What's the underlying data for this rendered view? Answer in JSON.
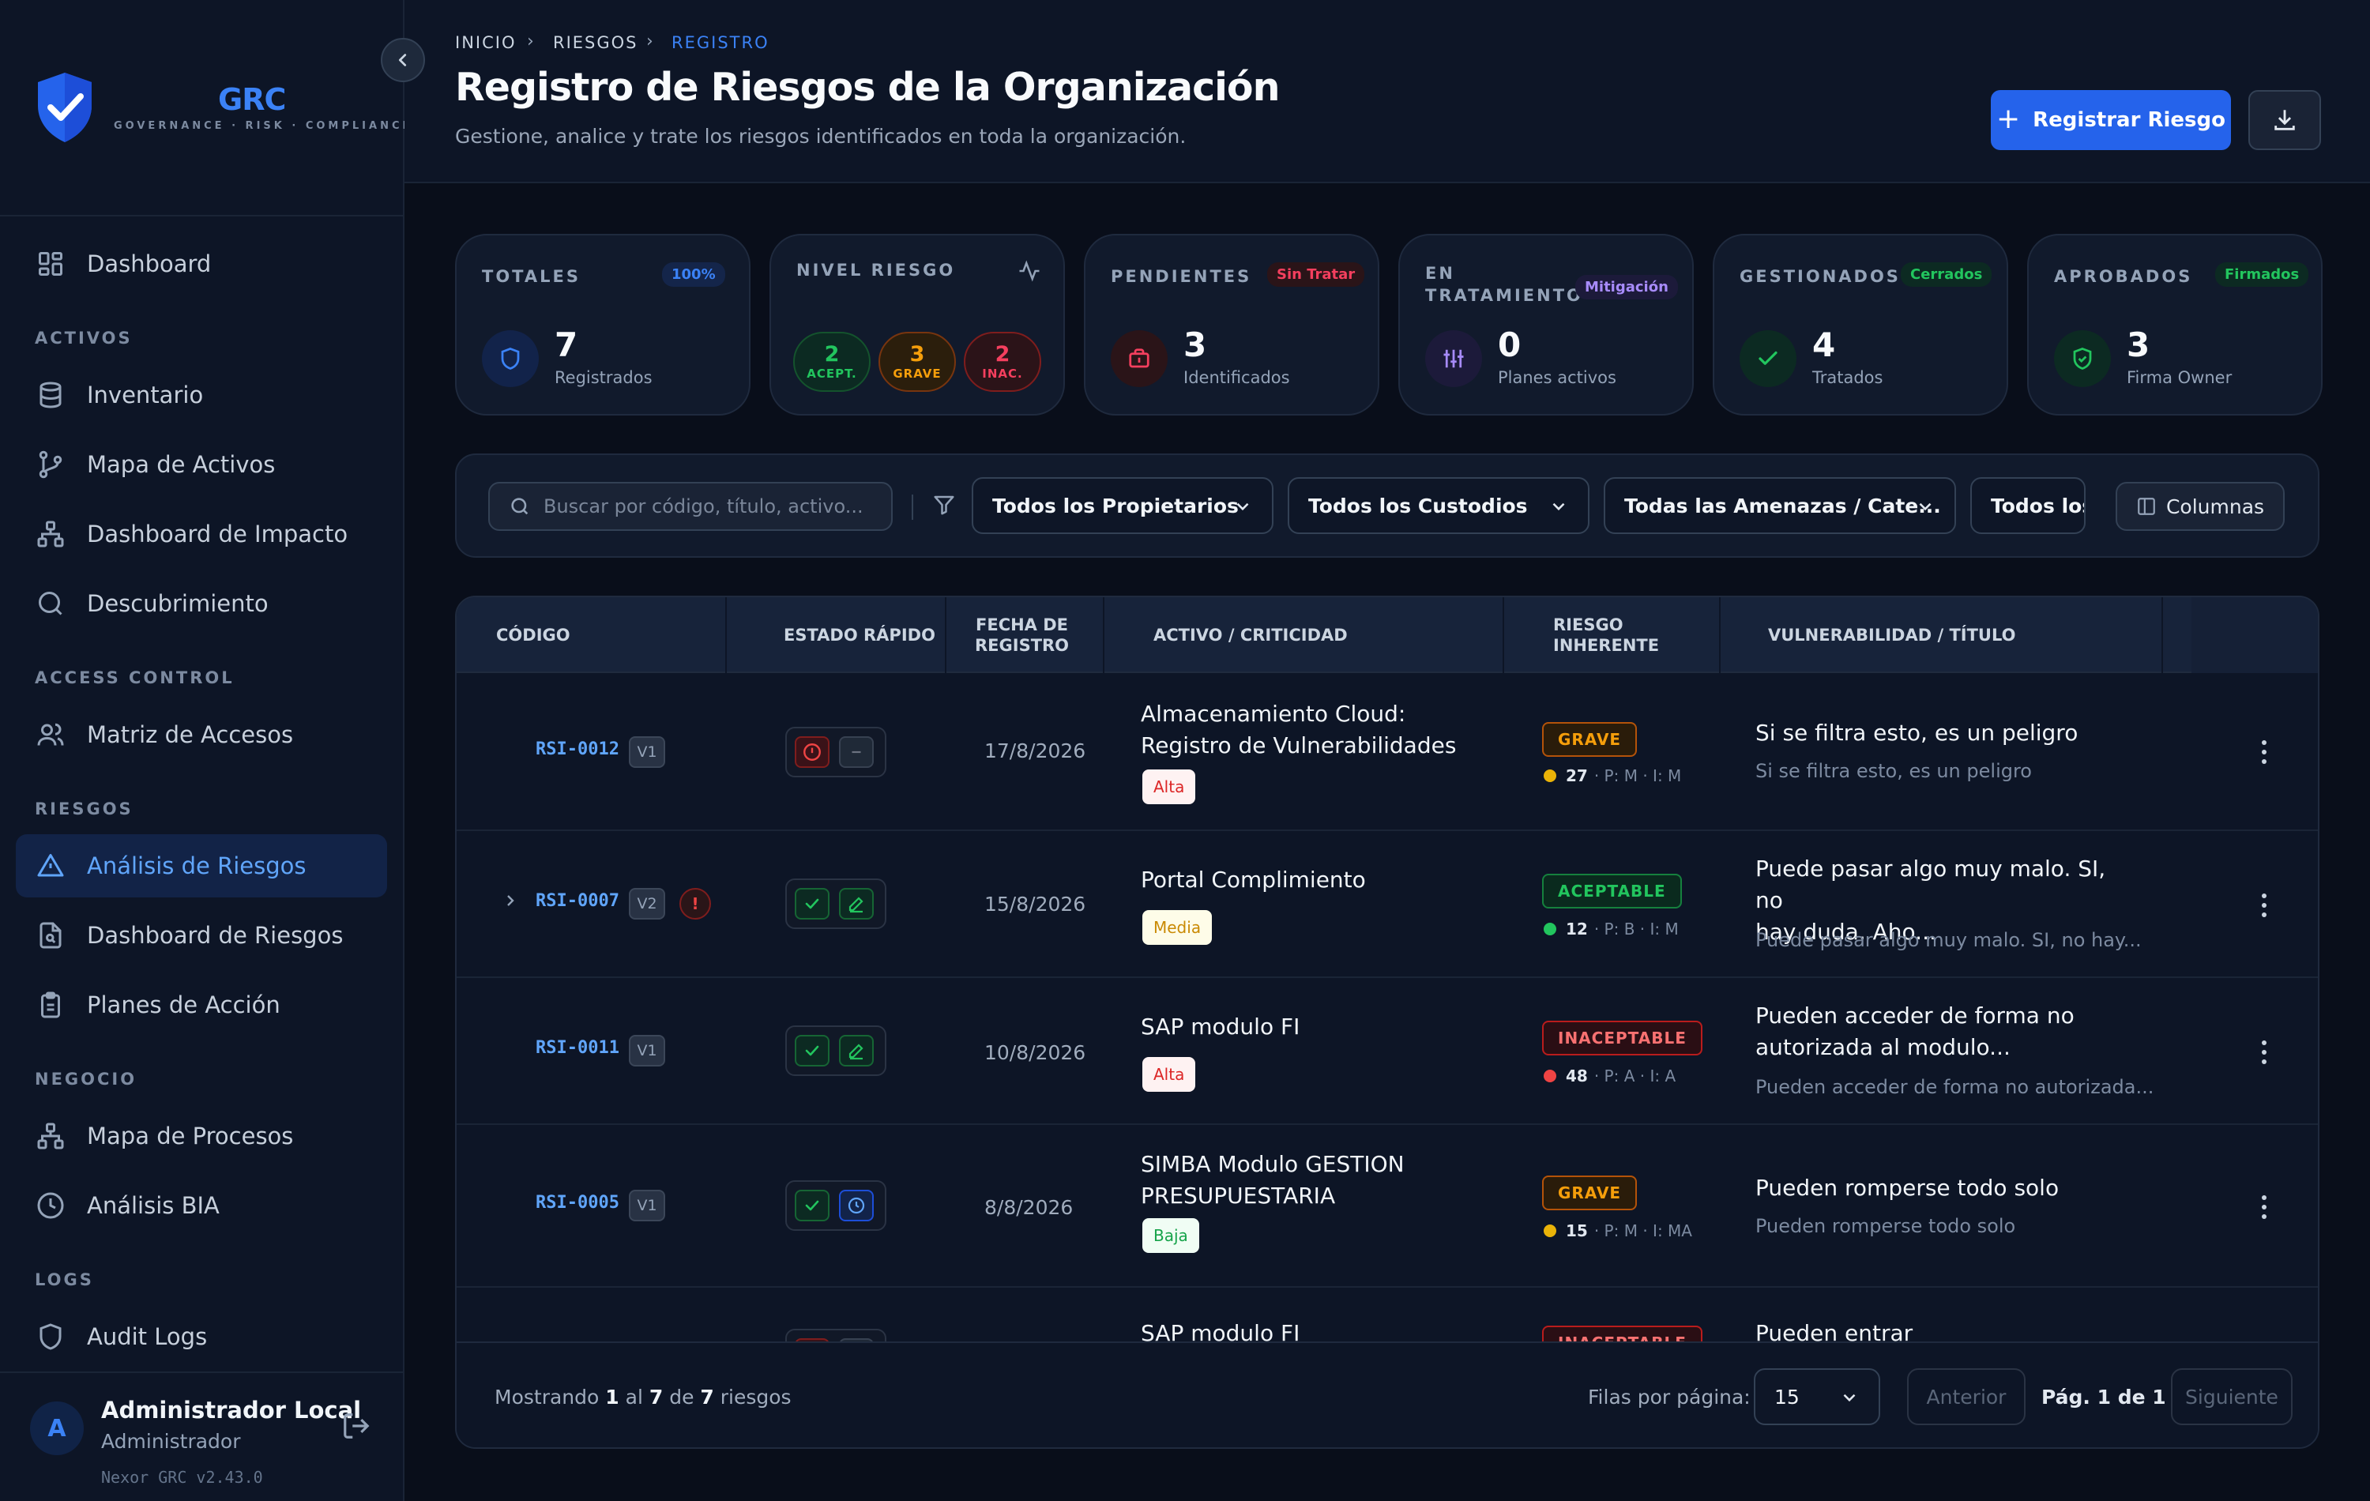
{
  "brand": {
    "name": "GRC",
    "tagline": "GOVERNANCE · RISK · COMPLIANCE",
    "accent": "#3b82f6"
  },
  "sidebar": {
    "dashboard": "Dashboard",
    "sections": [
      "ACTIVOS",
      "ACCESS CONTROL",
      "RIESGOS",
      "NEGOCIO",
      "LOGS"
    ],
    "items": [
      {
        "label": "Inventario",
        "icon": "database-icon"
      },
      {
        "label": "Mapa de Activos",
        "icon": "git-branch-icon"
      },
      {
        "label": "Dashboard de Impacto",
        "icon": "hierarchy-icon"
      },
      {
        "label": "Descubrimiento",
        "icon": "search-icon"
      },
      {
        "label": "Matriz de Accesos",
        "icon": "users-icon"
      },
      {
        "label": "Análisis de Riesgos",
        "icon": "warning-icon",
        "active": true
      },
      {
        "label": "Dashboard de Riesgos",
        "icon": "file-search-icon"
      },
      {
        "label": "Planes de Acción",
        "icon": "clipboard-icon"
      },
      {
        "label": "Mapa de Procesos",
        "icon": "hierarchy-icon"
      },
      {
        "label": "Análisis BIA",
        "icon": "clock-icon"
      },
      {
        "label": "Audit Logs",
        "icon": "shield-icon"
      }
    ],
    "user": {
      "initial": "A",
      "name": "Administrador Local",
      "role": "Administrador"
    },
    "version": "Nexor GRC v2.43.0"
  },
  "breadcrumb": [
    "INICIO",
    "RIESGOS",
    "REGISTRO"
  ],
  "page": {
    "title": "Registro de Riesgos de la Organización",
    "subtitle": "Gestione, analice y trate los riesgos identificados en toda la organización.",
    "primary_button": "Registrar Riesgo"
  },
  "stats": {
    "totales": {
      "title": "TOTALES",
      "badge": "100%",
      "value": "7",
      "label": "Registrados"
    },
    "nivel": {
      "title": "NIVEL RIESGO",
      "pills": [
        {
          "value": "2",
          "label": "ACEPT."
        },
        {
          "value": "3",
          "label": "GRAVE"
        },
        {
          "value": "2",
          "label": "INAC."
        }
      ]
    },
    "pendientes": {
      "title": "PENDIENTES",
      "badge": "Sin Tratar",
      "value": "3",
      "label": "Identificados"
    },
    "tratamiento": {
      "title_1": "EN",
      "title_2": "TRATAMIENTO",
      "badge": "Mitigación",
      "value": "0",
      "label": "Planes activos"
    },
    "gestionados": {
      "title": "GESTIONADOS",
      "badge": "Cerrados",
      "value": "4",
      "label": "Tratados"
    },
    "aprobados": {
      "title": "APROBADOS",
      "badge": "Firmados",
      "value": "3",
      "label": "Firma Owner"
    }
  },
  "filters": {
    "search_placeholder": "Buscar por código, título, activo...",
    "owners": "Todos los Propietarios",
    "custodians": "Todos los Custodios",
    "threats": "Todas las Amenazas / Cate...",
    "more": "Todos los",
    "columns": "Columnas"
  },
  "table": {
    "headers": {
      "code": "CÓDIGO",
      "quick": "ESTADO RÁPIDO",
      "date_1": "FECHA DE",
      "date_2": "REGISTRO",
      "asset": "ACTIVO / CRITICIDAD",
      "risk_1": "RIESGO",
      "risk_2": "INHERENTE",
      "vuln": "VULNERABILIDAD / TÍTULO"
    },
    "rows": [
      {
        "code": "RSI-0012",
        "version": "V1",
        "date": "17/8/2026",
        "asset_1": "Almacenamiento Cloud:",
        "asset_2": "Registro de Vulnerabilidades",
        "criticality": "Alta",
        "risk": "GRAVE",
        "score": "27",
        "score_detail": "· P: M · I: M",
        "title_1": "Si se filtra esto, es un peligro",
        "title_2": "",
        "subtitle": "Si se filtra esto, es un peligro"
      },
      {
        "code": "RSI-0007",
        "version": "V2",
        "alert": "!",
        "date": "15/8/2026",
        "asset_1": "Portal Complimiento",
        "asset_2": "",
        "criticality": "Media",
        "risk": "ACEPTABLE",
        "score": "12",
        "score_detail": "· P: B · I: M",
        "title_1": "Puede pasar algo muy malo. SI, no",
        "title_2": "hay duda. Aho...",
        "subtitle": "Puede pasar algo muy malo. SI, no hay..."
      },
      {
        "code": "RSI-0011",
        "version": "V1",
        "date": "10/8/2026",
        "asset_1": "SAP modulo FI",
        "asset_2": "",
        "criticality": "Alta",
        "risk": "INACEPTABLE",
        "score": "48",
        "score_detail": "· P: A · I: A",
        "title_1": "Pueden acceder de forma no",
        "title_2": "autorizada al modulo...",
        "subtitle": "Pueden acceder de forma no autorizada..."
      },
      {
        "code": "RSI-0005",
        "version": "V1",
        "date": "8/8/2026",
        "asset_1": "SIMBA Modulo GESTION",
        "asset_2": "PRESUPUESTARIA",
        "criticality": "Baja",
        "risk": "GRAVE",
        "score": "15",
        "score_detail": "· P: M · I: MA",
        "title_1": "Pueden romperse todo solo",
        "title_2": "",
        "subtitle": "Pueden romperse todo solo"
      },
      {
        "asset_1": "SAP modulo FI",
        "risk": "INACEPTABLE",
        "title_1": "Pueden entrar"
      }
    ]
  },
  "footer": {
    "showing_1": "Mostrando",
    "from": "1",
    "al": "al",
    "to": "7",
    "de": "de",
    "total": "7",
    "riesgos": "riesgos",
    "rows_per_page_label": "Filas por página:",
    "rows_per_page": "15",
    "prev": "Anterior",
    "page_info": "Pág. 1 de 1",
    "next": "Siguiente"
  },
  "colors": {
    "grave": "#f59e0b",
    "aceptable": "#22c55e",
    "inaceptable": "#ef4444",
    "primary": "#2563eb"
  }
}
